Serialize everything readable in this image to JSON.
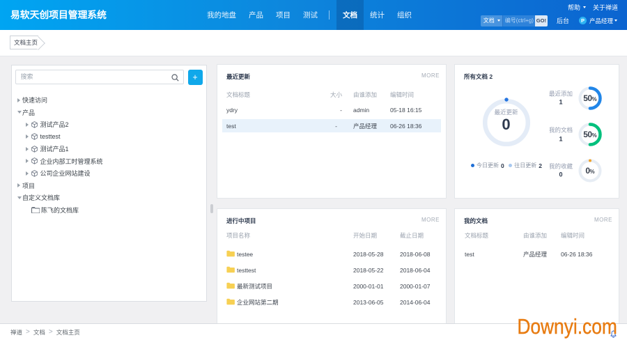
{
  "header": {
    "brand": "易软天创项目管理系统",
    "nav": [
      {
        "label": "我的地盘",
        "active": false
      },
      {
        "label": "产品",
        "active": false
      },
      {
        "label": "项目",
        "active": false
      },
      {
        "label": "测试",
        "active": false
      },
      {
        "label": "文档",
        "active": true
      },
      {
        "label": "统计",
        "active": false
      },
      {
        "label": "组织",
        "active": false
      }
    ],
    "divider_after": 3,
    "help": "帮助",
    "about": "关于禅道",
    "search": {
      "module": "文档",
      "placeholder": "编号(ctrl+g)",
      "go": "GO!"
    },
    "admin": "后台",
    "avatar": "P",
    "user": "产品经理"
  },
  "tabbar": {
    "active_tab": "文档主页"
  },
  "sidebar": {
    "search_placeholder": "搜索",
    "add_label": "+",
    "tree": [
      {
        "label": "快速访问",
        "level": 0,
        "caret": "collapsed",
        "icon": ""
      },
      {
        "label": "产品",
        "level": 0,
        "caret": "expanded",
        "icon": ""
      },
      {
        "label": "测试产品2",
        "level": 1,
        "caret": "collapsed",
        "icon": "product"
      },
      {
        "label": "testtest",
        "level": 1,
        "caret": "collapsed",
        "icon": "product"
      },
      {
        "label": "测试产品1",
        "level": 1,
        "caret": "collapsed",
        "icon": "product"
      },
      {
        "label": "企业内部工时管理系统",
        "level": 1,
        "caret": "collapsed",
        "icon": "product"
      },
      {
        "label": "公司企业网站建设",
        "level": 1,
        "caret": "collapsed",
        "icon": "product"
      },
      {
        "label": "项目",
        "level": 0,
        "caret": "collapsed",
        "icon": ""
      },
      {
        "label": "自定义文档库",
        "level": 0,
        "caret": "expanded",
        "icon": ""
      },
      {
        "label": "陈飞的文档库",
        "level": 1,
        "caret": "none",
        "icon": "folder"
      }
    ]
  },
  "cards": {
    "recent": {
      "title": "最近更新",
      "more": "MORE",
      "columns": [
        "文档标题",
        "大小",
        "由谁添加",
        "编辑时间"
      ],
      "rows": [
        {
          "title": "ydry",
          "size": "-",
          "who": "admin",
          "time": "05-18 16:15",
          "highlight": false
        },
        {
          "title": "test",
          "size": "-",
          "who": "产品经理",
          "time": "06-26 18:36",
          "highlight": true
        }
      ]
    },
    "alldocs": {
      "title": "所有文档 2",
      "donut": {
        "label": "最近更新",
        "value": "0",
        "percent": 0,
        "color": "#2575e0",
        "track": "#e4ecf7"
      },
      "legend": [
        {
          "label": "今日更新",
          "value": "0",
          "color": "#1f6fd6"
        },
        {
          "label": "往日更新",
          "value": "2",
          "color": "#a7c8ef"
        }
      ],
      "stats": [
        {
          "label": "最近添加",
          "value": "1",
          "percent": 50,
          "pct_text": "50",
          "color": "#2186e8"
        },
        {
          "label": "我的文档",
          "value": "1",
          "percent": 50,
          "pct_text": "50",
          "color": "#00c07d"
        },
        {
          "label": "我的收藏",
          "value": "0",
          "percent": 0,
          "pct_text": "0",
          "color": "#f0a32a"
        }
      ]
    },
    "projects": {
      "title": "进行中项目",
      "more": "MORE",
      "columns": [
        "项目名称",
        "开始日期",
        "截止日期"
      ],
      "rows": [
        {
          "name": "testee",
          "start": "2018-05-28",
          "end": "2018-06-08"
        },
        {
          "name": "testtest",
          "start": "2018-05-22",
          "end": "2018-06-04"
        },
        {
          "name": "最新测试项目",
          "start": "2000-01-01",
          "end": "2000-01-07"
        },
        {
          "name": "企业网站第二期",
          "start": "2013-06-05",
          "end": "2014-06-04"
        }
      ]
    },
    "mydocs": {
      "title": "我的文档",
      "more": "MORE",
      "columns": [
        "文档标题",
        "由谁添加",
        "编辑时间"
      ],
      "rows": [
        {
          "title": "test",
          "who": "产品经理",
          "time": "06-26 18:36"
        }
      ]
    }
  },
  "footer": {
    "breadcrumb": [
      "禅道",
      "文档",
      "文档主页"
    ]
  },
  "watermark": "Downyi.com",
  "colors": {
    "accent_blue": "#2186e8",
    "green": "#00c07d",
    "orange": "#f0a32a",
    "header_left": "#0ea7ef",
    "header_right": "#0b64d0",
    "folder_yellow": "#f6c344",
    "highlight_row": "#e8f2fb"
  }
}
